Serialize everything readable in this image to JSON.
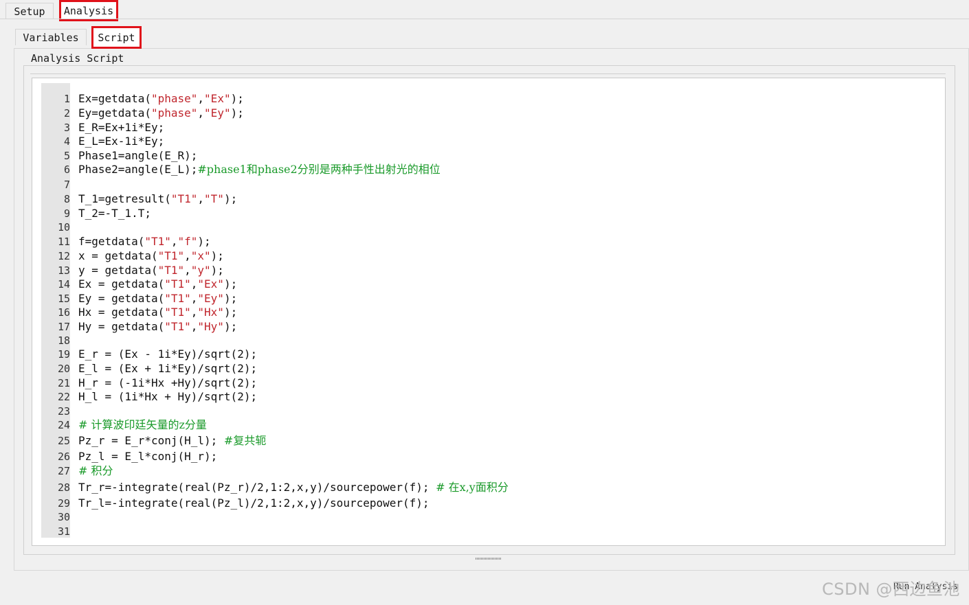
{
  "tabs": {
    "top": [
      {
        "label": "Setup"
      },
      {
        "label": "Analysis"
      }
    ],
    "sub": [
      {
        "label": "Variables"
      },
      {
        "label": "Script"
      }
    ]
  },
  "group_label": "Analysis Script",
  "editor": {
    "lines": [
      {
        "n": "1",
        "segs": [
          {
            "t": "Ex=getdata("
          },
          {
            "t": "\"phase\"",
            "c": "str"
          },
          {
            "t": ","
          },
          {
            "t": "\"Ex\"",
            "c": "str"
          },
          {
            "t": ");"
          }
        ]
      },
      {
        "n": "2",
        "segs": [
          {
            "t": "Ey=getdata("
          },
          {
            "t": "\"phase\"",
            "c": "str"
          },
          {
            "t": ","
          },
          {
            "t": "\"Ey\"",
            "c": "str"
          },
          {
            "t": ");"
          }
        ]
      },
      {
        "n": "3",
        "segs": [
          {
            "t": "E_R=Ex+1i*Ey;"
          }
        ]
      },
      {
        "n": "4",
        "segs": [
          {
            "t": "E_L=Ex-1i*Ey;"
          }
        ]
      },
      {
        "n": "5",
        "segs": [
          {
            "t": "Phase1=angle(E_R);"
          }
        ]
      },
      {
        "n": "6",
        "segs": [
          {
            "t": "Phase2=angle(E_L);"
          },
          {
            "t": "#phase1和phase2分别是两种手性出射光的相位",
            "c": "cm"
          }
        ]
      },
      {
        "n": "7",
        "segs": []
      },
      {
        "n": "8",
        "segs": [
          {
            "t": "T_1=getresult("
          },
          {
            "t": "\"T1\"",
            "c": "str"
          },
          {
            "t": ","
          },
          {
            "t": "\"T\"",
            "c": "str"
          },
          {
            "t": ");"
          }
        ]
      },
      {
        "n": "9",
        "segs": [
          {
            "t": "T_2=-T_1.T;"
          }
        ]
      },
      {
        "n": "10",
        "segs": []
      },
      {
        "n": "11",
        "segs": [
          {
            "t": "f=getdata("
          },
          {
            "t": "\"T1\"",
            "c": "str"
          },
          {
            "t": ","
          },
          {
            "t": "\"f\"",
            "c": "str"
          },
          {
            "t": ");"
          }
        ]
      },
      {
        "n": "12",
        "segs": [
          {
            "t": "x = getdata("
          },
          {
            "t": "\"T1\"",
            "c": "str"
          },
          {
            "t": ","
          },
          {
            "t": "\"x\"",
            "c": "str"
          },
          {
            "t": ");"
          }
        ]
      },
      {
        "n": "13",
        "segs": [
          {
            "t": "y = getdata("
          },
          {
            "t": "\"T1\"",
            "c": "str"
          },
          {
            "t": ","
          },
          {
            "t": "\"y\"",
            "c": "str"
          },
          {
            "t": ");"
          }
        ]
      },
      {
        "n": "14",
        "segs": [
          {
            "t": "Ex = getdata("
          },
          {
            "t": "\"T1\"",
            "c": "str"
          },
          {
            "t": ","
          },
          {
            "t": "\"Ex\"",
            "c": "str"
          },
          {
            "t": ");"
          }
        ]
      },
      {
        "n": "15",
        "segs": [
          {
            "t": "Ey = getdata("
          },
          {
            "t": "\"T1\"",
            "c": "str"
          },
          {
            "t": ","
          },
          {
            "t": "\"Ey\"",
            "c": "str"
          },
          {
            "t": ");"
          }
        ]
      },
      {
        "n": "16",
        "segs": [
          {
            "t": "Hx = getdata("
          },
          {
            "t": "\"T1\"",
            "c": "str"
          },
          {
            "t": ","
          },
          {
            "t": "\"Hx\"",
            "c": "str"
          },
          {
            "t": ");"
          }
        ]
      },
      {
        "n": "17",
        "segs": [
          {
            "t": "Hy = getdata("
          },
          {
            "t": "\"T1\"",
            "c": "str"
          },
          {
            "t": ","
          },
          {
            "t": "\"Hy\"",
            "c": "str"
          },
          {
            "t": ");"
          }
        ]
      },
      {
        "n": "18",
        "segs": []
      },
      {
        "n": "19",
        "segs": [
          {
            "t": "E_r = (Ex - 1i*Ey)/sqrt(2);"
          }
        ]
      },
      {
        "n": "20",
        "segs": [
          {
            "t": "E_l = (Ex + 1i*Ey)/sqrt(2);"
          }
        ]
      },
      {
        "n": "21",
        "segs": [
          {
            "t": "H_r = (-1i*Hx +Hy)/sqrt(2);"
          }
        ]
      },
      {
        "n": "22",
        "segs": [
          {
            "t": "H_l = (1i*Hx + Hy)/sqrt(2);"
          }
        ]
      },
      {
        "n": "23",
        "segs": []
      },
      {
        "n": "24",
        "segs": [
          {
            "t": "# 计算波印廷矢量的z分量",
            "c": "cm"
          }
        ]
      },
      {
        "n": "25",
        "segs": [
          {
            "t": "Pz_r = E_r*conj(H_l); "
          },
          {
            "t": "#复共轭",
            "c": "cm"
          }
        ]
      },
      {
        "n": "26",
        "segs": [
          {
            "t": "Pz_l = E_l*conj(H_r);"
          }
        ]
      },
      {
        "n": "27",
        "segs": [
          {
            "t": "# 积分",
            "c": "cm"
          }
        ]
      },
      {
        "n": "28",
        "segs": [
          {
            "t": "Tr_r=-integrate(real(Pz_r)/2,1:2,x,y)/sourcepower(f); "
          },
          {
            "t": "# 在x,y面积分",
            "c": "cm"
          }
        ]
      },
      {
        "n": "29",
        "segs": [
          {
            "t": "Tr_l=-integrate(real(Pz_l)/2,1:2,x,y)/sourcepower(f);"
          }
        ]
      },
      {
        "n": "30",
        "segs": []
      },
      {
        "n": "31",
        "segs": []
      }
    ]
  },
  "bottom": {
    "run_label": "Run Analysis",
    "watermark": "CSDN @西边鱼池"
  },
  "colors": {
    "string": "#c0262d",
    "comment": "#1a9a2a",
    "highlight": "#e0121a"
  }
}
